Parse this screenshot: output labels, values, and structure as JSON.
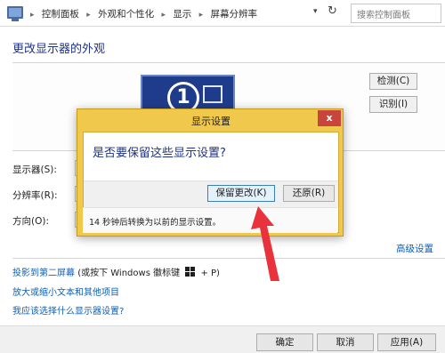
{
  "breadcrumb": {
    "items": [
      "控制面板",
      "外观和个性化",
      "显示",
      "屏幕分辨率"
    ],
    "separator": "▸"
  },
  "search": {
    "placeholder": "搜索控制面板"
  },
  "page": {
    "title": "更改显示器的外观"
  },
  "preview": {
    "monitor_number": "1",
    "detect_label": "检测(C)",
    "identify_label": "识别(I)"
  },
  "form": {
    "display_label": "显示器(S):",
    "resolution_label": "分辨率(R):",
    "orientation_label": "方向(O):"
  },
  "advanced_settings": "高级设置",
  "links": {
    "project_prefix": "投影到第二屏幕",
    "project_suffix_before": "(或按下 Windows 徽标键",
    "project_suffix_after": "+ P)",
    "enlarge_text": "放大或缩小文本和其他项目",
    "which_settings": "我应该选择什么显示器设置?"
  },
  "footer": {
    "ok_label": "确定",
    "cancel_label": "取消",
    "apply_label": "应用(A)"
  },
  "dialog": {
    "title": "显示设置",
    "close_glyph": "x",
    "question": "是否要保留这些显示设置?",
    "keep_label": "保留更改(K)",
    "revert_label": "还原(R)",
    "countdown_note": "14 秒钟后转换为以前的显示设置。"
  },
  "colors": {
    "dialog_frame": "#f0c84c",
    "close_button": "#c7453d",
    "link": "#0f5fb3",
    "heading": "#1e3287",
    "annotation_arrow": "#e8323c"
  },
  "icons": {
    "back": "left-arrow-icon",
    "forward": "right-arrow-icon",
    "up": "up-arrow-icon",
    "location": "monitor-icon",
    "refresh": "refresh-icon",
    "windows": "windows-logo-icon"
  }
}
